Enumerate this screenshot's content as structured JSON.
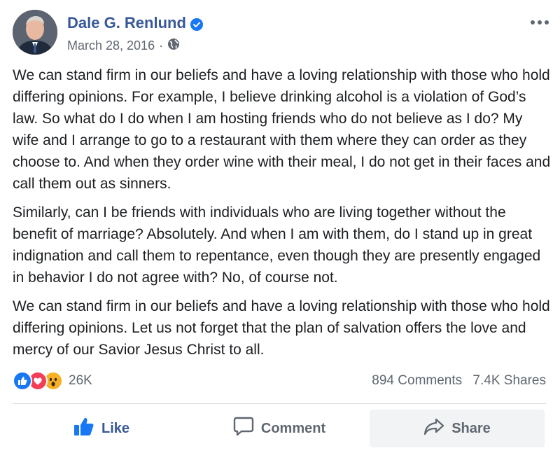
{
  "post": {
    "author": "Dale G. Renlund",
    "date": "March 28, 2016",
    "date_separator": "·",
    "privacy_icon": "globe-icon",
    "verified_icon": "verified-badge-icon",
    "more_icon": "more-options-icon",
    "paragraphs": [
      "We can stand firm in our beliefs and have a loving relationship with those who hold differing opinions. For example, I believe drinking alcohol is a violation of God’s law. So what do I do when I am hosting friends who do not believe as I do? My wife and I arrange to go to a restaurant with them where they can order as they choose to. And when they order wine with their meal, I do not get in their faces and call them out as sinners.",
      "Similarly, can I be friends with individuals who are living together without the benefit of marriage? Absolutely. And when I am with them, do I stand up in great indignation and call them to repentance, even though they are presently engaged in behavior I do not agree with? No, of course not.",
      "We can stand firm in our beliefs and have a loving relationship with those who hold differing opinions. Let us not forget that the plan of salvation offers the love and mercy of our Savior Jesus Christ to all."
    ]
  },
  "stats": {
    "reaction_icons": [
      "like-reaction-icon",
      "love-reaction-icon",
      "wow-reaction-icon"
    ],
    "reactions_count": "26K",
    "comments": "894 Comments",
    "shares": "7.4K Shares"
  },
  "actions": {
    "like": "Like",
    "comment": "Comment",
    "share": "Share"
  },
  "colors": {
    "brand_blue": "#385898",
    "like_blue": "#1877f2",
    "love_red": "#f33e58",
    "wow_yellow": "#f7b125",
    "muted_text": "#606770"
  }
}
